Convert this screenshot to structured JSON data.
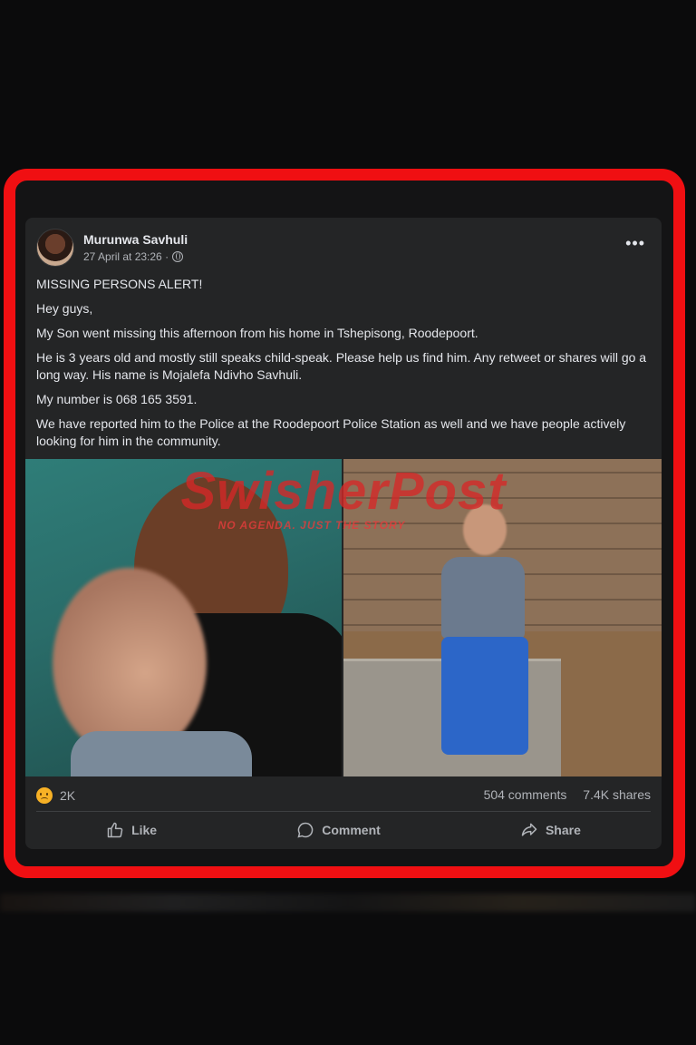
{
  "post": {
    "author": "Murunwa Savhuli",
    "timestamp": "27 April at 23:26 ·",
    "privacy_icon": "globe-icon",
    "more_icon": "•••",
    "paragraphs": [
      "MISSING PERSONS ALERT!",
      "Hey guys,",
      "My Son went missing this afternoon from his home in Tshepisong, Roodepoort.",
      "He is 3 years old and mostly still speaks child-speak. Please help us find him. Any retweet or shares will go a long way. His name is Mojalefa Ndivho Savhuli.",
      "My number is 068 165 3591.",
      "We have reported him to the Police at the Roodepoort Police Station as well and we have people actively looking for him in the community."
    ],
    "watermark": {
      "title": "SwisherPost",
      "tagline": "NO AGENDA. JUST THE STORY"
    },
    "reaction_icon": "sad-reaction-icon",
    "reactions_count": "2K",
    "comments": "504 comments",
    "shares": "7.4K shares",
    "actions": {
      "like": "Like",
      "comment": "Comment",
      "share": "Share"
    }
  },
  "colors": {
    "highlight_border": "#f00f12",
    "card": "#242526",
    "text": "#e4e6eb",
    "muted": "#b0b3b8"
  }
}
